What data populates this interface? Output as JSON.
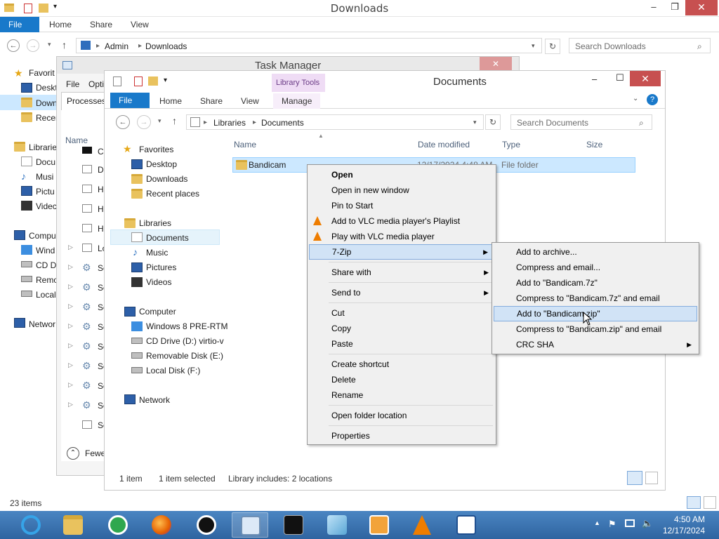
{
  "bg_window": {
    "title": "Downloads",
    "tabs": [
      "File",
      "Home",
      "Share",
      "View"
    ],
    "address": [
      "Admin",
      "Downloads"
    ],
    "search_placeholder": "Search Downloads",
    "nav": [
      "Favorit",
      "Deskt",
      "Down",
      "Recer",
      "Librarie",
      "Docu",
      "Musi",
      "Pictu",
      "Videc",
      "Compu",
      "Wind",
      "CD D",
      "Remo",
      "Local",
      "Networ"
    ],
    "status_items": "23 items"
  },
  "task_manager": {
    "title": "Task Manager",
    "menu": [
      "File",
      "Opti"
    ],
    "tab": "Processes",
    "col": "Name",
    "rows": [
      "C",
      "De",
      "He",
      "He",
      "He",
      "Lo",
      "Se",
      "Se",
      "Se",
      "Se",
      "Se",
      "Se",
      "Se",
      "Se",
      "Se"
    ],
    "fewer": "Fewe"
  },
  "doc_window": {
    "title": "Documents",
    "library_tools": "Library Tools",
    "tabs": [
      "File",
      "Home",
      "Share",
      "View",
      "Manage"
    ],
    "address": [
      "Libraries",
      "Documents"
    ],
    "search_placeholder": "Search Documents",
    "nav": {
      "favorites": "Favorites",
      "desktop": "Desktop",
      "downloads": "Downloads",
      "recent": "Recent places",
      "libraries": "Libraries",
      "documents": "Documents",
      "music": "Music",
      "pictures": "Pictures",
      "videos": "Videos",
      "computer": "Computer",
      "win8": "Windows 8 PRE-RTM",
      "cddrive": "CD Drive (D:) virtio-v",
      "removable": "Removable Disk (E:)",
      "localdisk": "Local Disk (F:)",
      "network": "Network"
    },
    "columns": [
      "Name",
      "Date modified",
      "Type",
      "Size"
    ],
    "file": {
      "name": "Bandicam",
      "date": "12/17/2024 4:48 AM",
      "type": "File folder"
    },
    "status": {
      "count": "1 item",
      "selected": "1 item selected",
      "library": "Library includes: 2 locations"
    }
  },
  "context_menu": {
    "items": [
      "Open",
      "Open in new window",
      "Pin to Start",
      "Add to VLC media player's Playlist",
      "Play with VLC media player",
      "7-Zip",
      "Share with",
      "Send to",
      "Cut",
      "Copy",
      "Paste",
      "Create shortcut",
      "Delete",
      "Rename",
      "Open folder location",
      "Properties"
    ]
  },
  "submenu": {
    "items": [
      "Add to archive...",
      "Compress and email...",
      "Add to \"Bandicam.7z\"",
      "Compress to \"Bandicam.7z\" and email",
      "Add to \"Bandicam.zip\"",
      "Compress to \"Bandicam.zip\" and email",
      "CRC SHA"
    ]
  },
  "taskbar": {
    "time": "4:50 AM",
    "date": "12/17/2024"
  },
  "colors": {
    "accent": "#1979ca",
    "taskbar": "#3a74b0",
    "selection": "#cce8ff",
    "menu_highlight": "#d1e3f6"
  }
}
